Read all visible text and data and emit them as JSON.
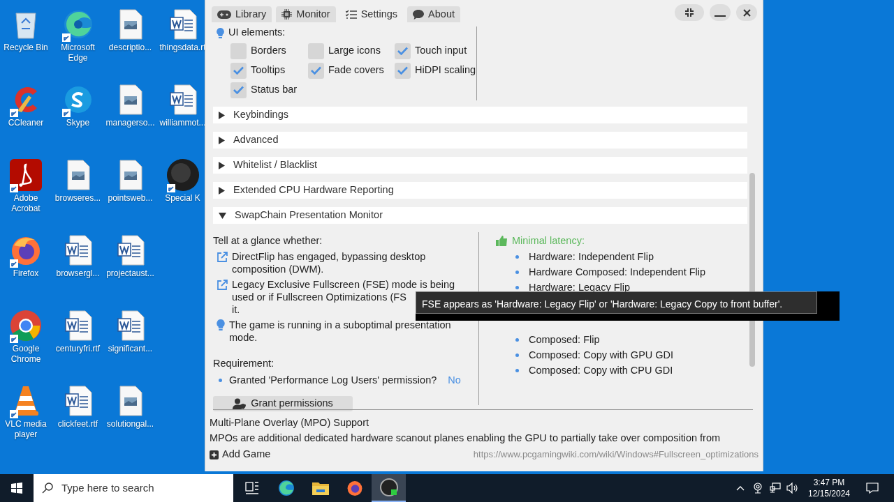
{
  "desktop_icons": [
    {
      "label": "Recycle Bin",
      "kind": "bin"
    },
    {
      "label": "Microsoft Edge",
      "kind": "edge"
    },
    {
      "label": "descriptio...",
      "kind": "image"
    },
    {
      "label": "thingsdata.rt",
      "kind": "word"
    },
    {
      "label": "CCleaner",
      "kind": "ccleaner"
    },
    {
      "label": "Skype",
      "kind": "skype"
    },
    {
      "label": "managerso...",
      "kind": "image"
    },
    {
      "label": "williammot...",
      "kind": "word"
    },
    {
      "label": "Adobe Acrobat",
      "kind": "acrobat"
    },
    {
      "label": "browseres...",
      "kind": "image"
    },
    {
      "label": "pointsweb...",
      "kind": "image"
    },
    {
      "label": "Special K",
      "kind": "disc"
    },
    {
      "label": "Firefox",
      "kind": "firefox"
    },
    {
      "label": "browsergl...",
      "kind": "word"
    },
    {
      "label": "projectaust...",
      "kind": "word"
    },
    {
      "kind": "empty"
    },
    {
      "label": "Google Chrome",
      "kind": "chrome"
    },
    {
      "label": "centuryfri.rtf",
      "kind": "word"
    },
    {
      "label": "significant...",
      "kind": "word"
    },
    {
      "kind": "empty"
    },
    {
      "label": "VLC media player",
      "kind": "vlc"
    },
    {
      "label": "clickfeet.rtf",
      "kind": "word"
    },
    {
      "label": "solutiongal...",
      "kind": "image"
    }
  ],
  "window": {
    "tabs": [
      {
        "label": "Library",
        "kind": "gamepad",
        "selected": false
      },
      {
        "label": "Monitor",
        "kind": "chip",
        "selected": false
      },
      {
        "label": "Settings",
        "kind": "list",
        "selected": true
      },
      {
        "label": "About",
        "kind": "chat",
        "selected": false
      }
    ],
    "ui_elements": {
      "title": "UI elements:",
      "options": [
        {
          "label": "Borders",
          "checked": false
        },
        {
          "label": "Large icons",
          "checked": false
        },
        {
          "label": "Touch input",
          "checked": true
        },
        {
          "label": "Tooltips",
          "checked": true
        },
        {
          "label": "Fade covers",
          "checked": true
        },
        {
          "label": "HiDPI scaling",
          "checked": true
        },
        {
          "label": "Status bar",
          "checked": true
        }
      ]
    },
    "sections": [
      {
        "title": "Keybindings",
        "expanded": false
      },
      {
        "title": "Advanced",
        "expanded": false
      },
      {
        "title": "Whitelist / Blacklist",
        "expanded": false
      },
      {
        "title": "Extended CPU Hardware Reporting",
        "expanded": false
      },
      {
        "title": "SwapChain Presentation Monitor",
        "expanded": true
      }
    ],
    "swapchain": {
      "intro": "Tell at a glance whether:",
      "items": [
        {
          "kind": "link",
          "lines": [
            "DirectFlip has engaged, bypassing desktop",
            "composition (DWM)."
          ]
        },
        {
          "kind": "link",
          "lines": [
            "Legacy Exclusive Fullscreen (FSE) mode is being",
            "used or if Fullscreen Optimizations (FS",
            "it."
          ]
        },
        {
          "kind": "tip",
          "lines": [
            "The game is running in a suboptimal presentation",
            "mode."
          ]
        }
      ],
      "requirement": "Requirement:",
      "requirement_items": [
        {
          "text": "Granted 'Performance Log Users' permission?",
          "value": "No"
        }
      ],
      "button": "Grant permissions",
      "minimal_title": "Minimal latency:",
      "minimal_items": [
        "Hardware: Independent Flip",
        "Hardware Composed: Independent Flip",
        "Hardware: Legacy Flip"
      ],
      "undesirable_items": [
        "Composed: Flip",
        "Composed: Copy with GPU GDI",
        "Composed: Copy with CPU GDI"
      ]
    },
    "mpo": {
      "title": "Multi-Plane Overlay (MPO) Support",
      "text": "MPOs are additional dedicated hardware scanout planes enabling the GPU to partially take over composition from"
    },
    "footer": {
      "add_game": "Add Game",
      "url": "https://www.pcgamingwiki.com/wiki/Windows#Fullscreen_optimizations"
    },
    "tooltip": {
      "text": "FSE appears as 'Hardware: Legacy Flip' or 'Hardware: Legacy Copy to front buffer'."
    }
  },
  "taskbar": {
    "search_placeholder": "Type here to search",
    "apps": [
      {
        "kind": "taskview",
        "active": false
      },
      {
        "kind": "edge",
        "active": false
      },
      {
        "kind": "folder",
        "active": false
      },
      {
        "kind": "firefox",
        "active": false
      },
      {
        "kind": "disc",
        "active": true
      }
    ],
    "time": "3:47 PM",
    "date": "12/15/2024"
  }
}
